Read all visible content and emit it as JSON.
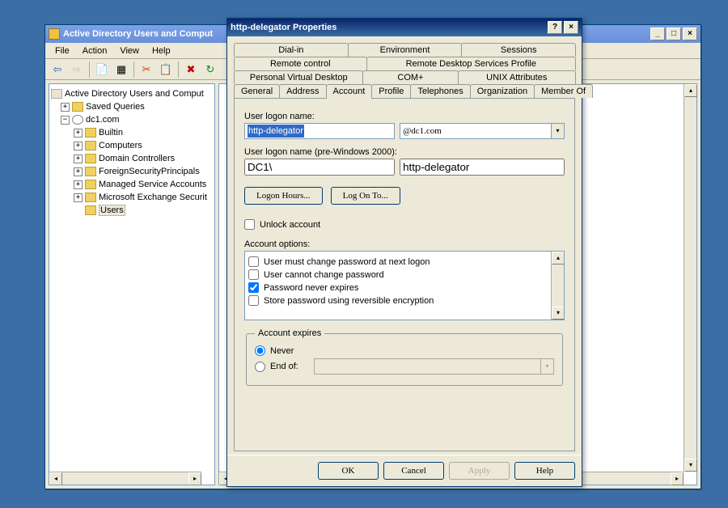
{
  "main_window": {
    "title": "Active Directory Users and Comput",
    "menus": [
      "File",
      "Action",
      "View",
      "Help"
    ],
    "toolbar_icons": [
      "back-arrow",
      "forward-arrow",
      "up-arrow",
      "list-icon",
      "table-icon",
      "cut-icon",
      "copy-icon",
      "delete-icon",
      "refresh-icon"
    ]
  },
  "tree": {
    "root": "Active Directory Users and Comput",
    "items": [
      {
        "label": "Saved Queries"
      },
      {
        "label": "dc1.com",
        "children": [
          {
            "label": "Builtin"
          },
          {
            "label": "Computers"
          },
          {
            "label": "Domain Controllers"
          },
          {
            "label": "ForeignSecurityPrincipals"
          },
          {
            "label": "Managed Service Accounts"
          },
          {
            "label": "Microsoft Exchange Securit"
          },
          {
            "label": "Users",
            "selected": true
          }
        ]
      }
    ]
  },
  "dialog": {
    "title": "http-delegator Properties",
    "tabs_row1": [
      "Dial-in",
      "Environment",
      "Sessions"
    ],
    "tabs_row2": [
      "Remote control",
      "Remote Desktop Services Profile"
    ],
    "tabs_row3": [
      "Personal Virtual Desktop",
      "COM+",
      "UNIX Attributes"
    ],
    "tabs_row4": [
      "General",
      "Address",
      "Account",
      "Profile",
      "Telephones",
      "Organization",
      "Member Of"
    ],
    "active_tab": "Account",
    "logon_name_label": "User logon name:",
    "logon_name_value": "http-delegator",
    "logon_domain": "@dc1.com",
    "pre2000_label": "User logon name (pre-Windows 2000):",
    "pre2000_domain": "DC1\\",
    "pre2000_user": "http-delegator",
    "btn_logon_hours": "Logon Hours...",
    "btn_logon_to": "Log On To...",
    "unlock_label": "Unlock account",
    "options_label": "Account options:",
    "options": [
      {
        "label": "User must change password at next logon",
        "checked": false
      },
      {
        "label": "User cannot change password",
        "checked": false
      },
      {
        "label": "Password never expires",
        "checked": true
      },
      {
        "label": "Store password using reversible encryption",
        "checked": false
      }
    ],
    "expires_legend": "Account expires",
    "expires_never": "Never",
    "expires_endof": "End of:",
    "buttons": {
      "ok": "OK",
      "cancel": "Cancel",
      "apply": "Apply",
      "help": "Help"
    }
  }
}
